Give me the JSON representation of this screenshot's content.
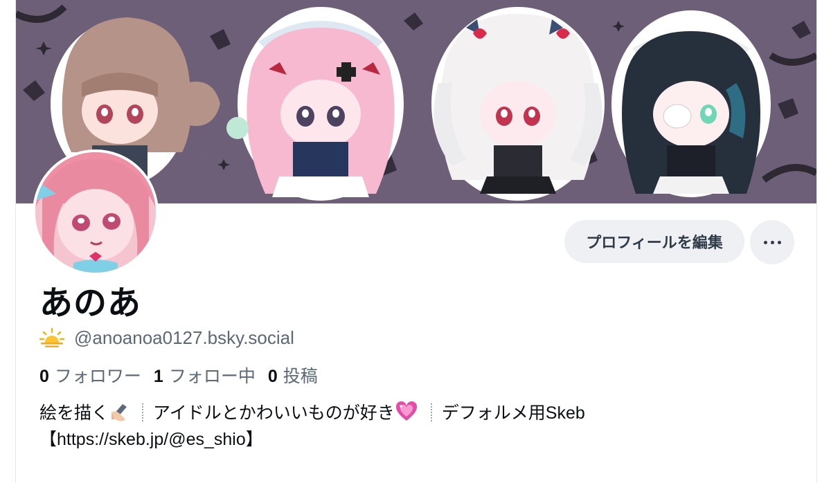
{
  "profile": {
    "display_name": "あのあ",
    "handle": "@anoanoa0127.bsky.social",
    "handle_icon": "sun-behind-cloud-icon",
    "edit_profile_label": "プロフィールを編集",
    "more_icon": "more-dots-icon",
    "stats": {
      "followers_count": "0",
      "followers_label": "フォロワー",
      "following_count": "1",
      "following_label": "フォロー中",
      "posts_count": "0",
      "posts_label": "投稿"
    },
    "bio": {
      "part1": "絵を描く",
      "part2": "アイドルとかわいいものが好き",
      "part3": "デフォルメ用Skeb",
      "line2": "【https://skeb.jp/@es_shio】",
      "emoji1": "writing-hand-icon",
      "emoji2": "sparkling-heart-icon"
    }
  },
  "colors": {
    "banner_bg": "#6d5f78",
    "button_bg": "#eef0f3",
    "secondary_text": "#5a6877",
    "primary_text": "#0b0f14"
  }
}
